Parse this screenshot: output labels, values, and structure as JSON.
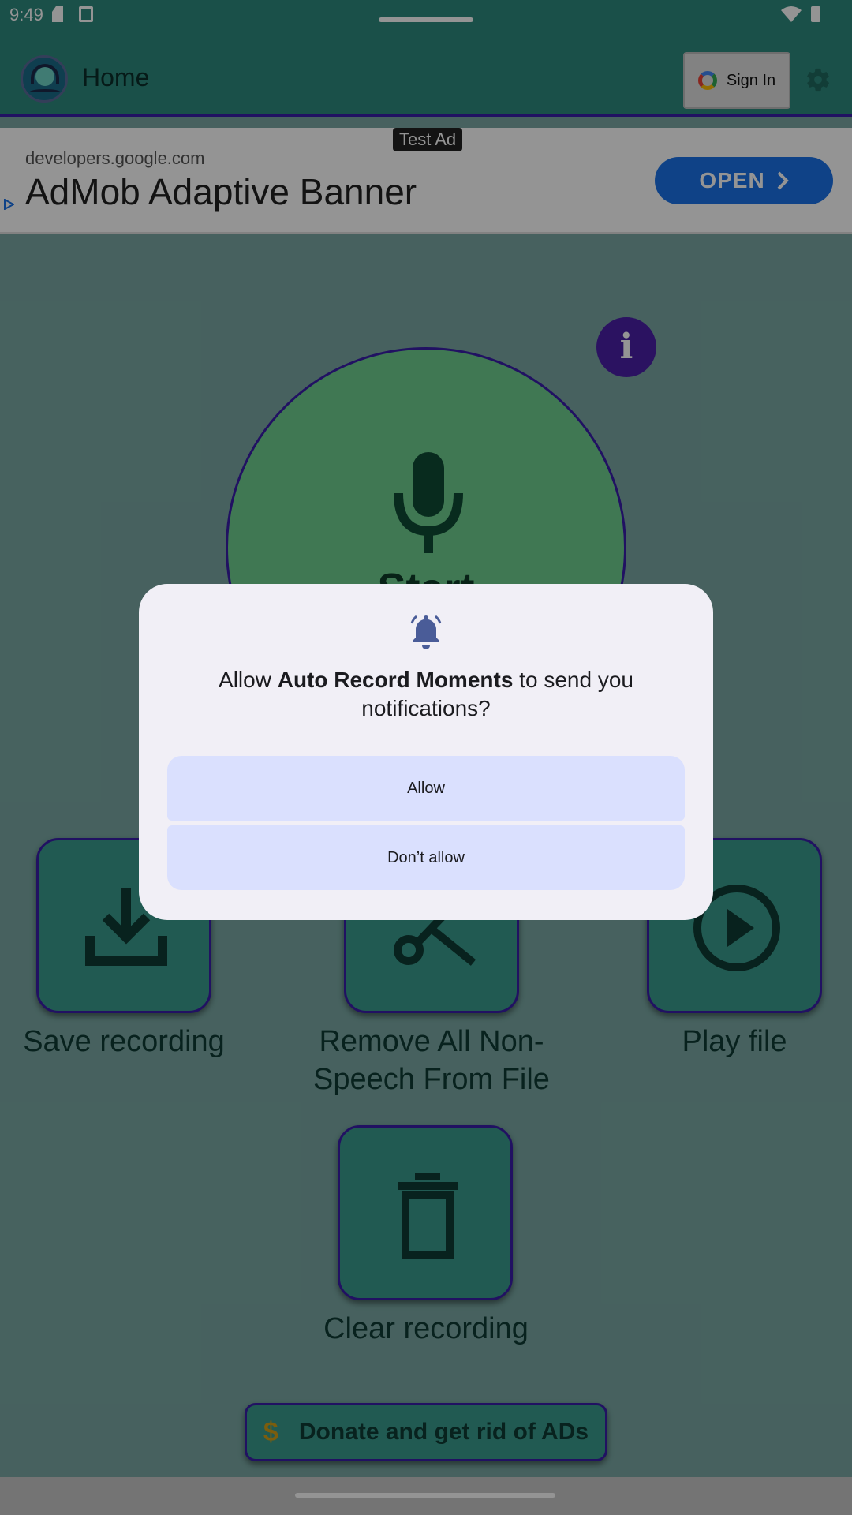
{
  "status_bar": {
    "time": "9:49"
  },
  "app_bar": {
    "title": "Home",
    "sign_in_label": "Sign In"
  },
  "ad": {
    "label": "Test Ad",
    "domain": "developers.google.com",
    "title": "AdMob Adaptive Banner",
    "cta": "OPEN"
  },
  "main": {
    "info_label": "i",
    "start_label": "Start",
    "actions": [
      {
        "label": "Save recording",
        "icon": "download-icon"
      },
      {
        "label": "Remove All Non-Speech From File",
        "icon": "cut-icon"
      },
      {
        "label": "Play file",
        "icon": "play-icon"
      },
      {
        "label": "Clear recording",
        "icon": "trash-icon"
      }
    ],
    "donate": {
      "symbol": "$",
      "label": "Donate and get rid of ADs"
    }
  },
  "dialog": {
    "prefix": "Allow ",
    "app_name": "Auto Record Moments",
    "suffix": " to send you notifications?",
    "allow_label": "Allow",
    "deny_label": "Don’t allow"
  },
  "colors": {
    "toolbar": "#2e8a7e",
    "accent": "#3a1eaa",
    "info": "#4b1fa8",
    "start": "#6fcf8f",
    "dialog_button": "#dae0fe"
  }
}
